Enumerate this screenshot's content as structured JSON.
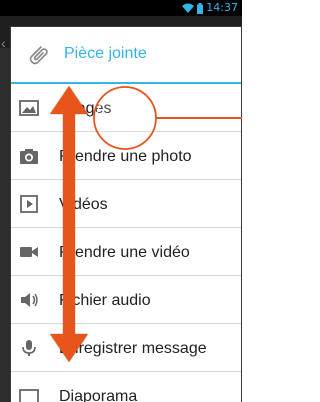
{
  "status_bar": {
    "time": "14:37",
    "icons": [
      "wifi-icon",
      "battery-icon"
    ]
  },
  "dialog": {
    "title": "Pièce jointe",
    "title_icon": "paperclip-icon",
    "items": [
      {
        "label": "Images",
        "icon": "image-icon"
      },
      {
        "label": "Prendre une photo",
        "icon": "camera-icon"
      },
      {
        "label": "Vidéos",
        "icon": "video-file-icon"
      },
      {
        "label": "Prendre une vidéo",
        "icon": "video-camera-icon"
      },
      {
        "label": "Fichier audio",
        "icon": "audio-icon"
      },
      {
        "label": "Enregistrer message",
        "icon": "microphone-icon"
      },
      {
        "label": "Diaporama",
        "icon": "slideshow-icon"
      }
    ]
  },
  "annotation": {
    "color": "#e8541e",
    "marker": "circle-highlight",
    "indicator": "double-arrow-scroll"
  },
  "colors": {
    "accent": "#33b5e5",
    "annotation": "#e8541e"
  }
}
